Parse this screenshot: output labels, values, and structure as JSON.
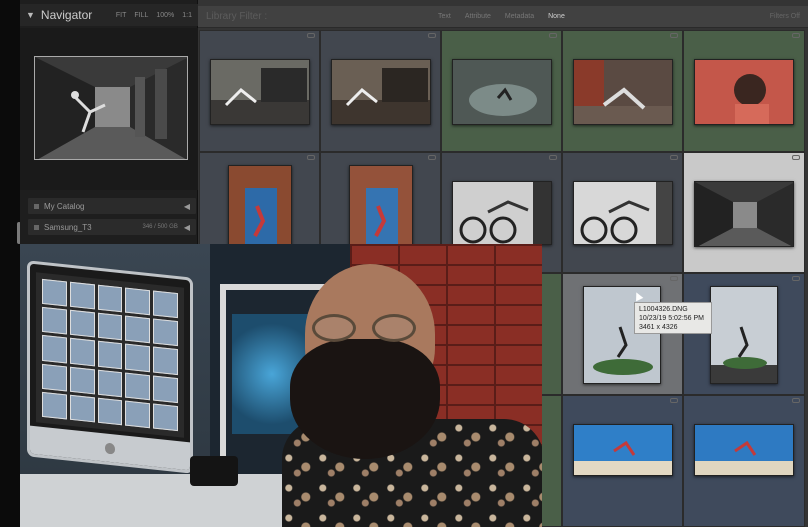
{
  "navigator": {
    "title": "Navigator",
    "zoom_options": [
      "FIT",
      "FILL",
      "100%",
      "1:1"
    ]
  },
  "left_panel": {
    "rows": [
      {
        "label": "My Catalog",
        "meta": ""
      },
      {
        "label": "Samsung_T3",
        "meta": "346 / 500 GB"
      }
    ]
  },
  "filter_bar": {
    "label": "Library Filter :",
    "options": [
      "Text",
      "Attribute",
      "Metadata",
      "None"
    ],
    "active": "None",
    "filters_off": "Filters Off"
  },
  "tooltip": {
    "filename": "L1004326.DNG",
    "date": "10/23/19 5:02:56 PM",
    "dimensions": "3461 x 4326"
  }
}
